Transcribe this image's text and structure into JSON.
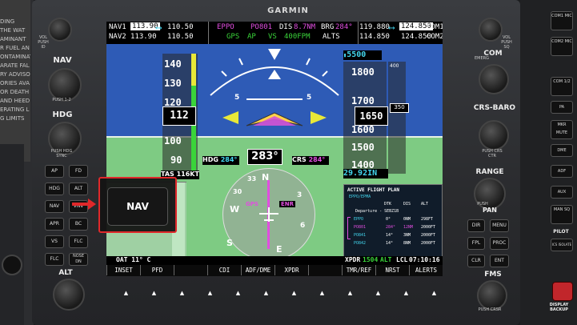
{
  "left_placard": {
    "lines": [
      "DING",
      "THE WAT",
      "AMINANT",
      "R FUEL AN",
      "ONTAMINAT",
      "ARATE FAL",
      "RY ADVISO",
      "ORIES AVA",
      "OR DEATH",
      "",
      "",
      "AND HEED",
      "ERATING L",
      "G LIMITS"
    ]
  },
  "left_controls": {
    "vol_label": "VOL PUSH ID",
    "nav_label": "NAV",
    "nav_push_label": "PUSH 1-2",
    "hdg_label": "HDG",
    "hdg_push_label": "PUSH HDG SYNC",
    "ap_buttons": [
      {
        "left": "AP",
        "right": "FD"
      },
      {
        "left": "HDG",
        "right": "ALT"
      },
      {
        "left": "NAV",
        "right": "VNV"
      },
      {
        "left": "APR",
        "right": "BC"
      },
      {
        "left": "VS",
        "right": "FLC"
      },
      {
        "left": "FLC",
        "right": "NOSE DN"
      }
    ],
    "alt_label": "ALT"
  },
  "top": {
    "brand": "GARMIN"
  },
  "nav_status": {
    "nav1_label": "NAV1",
    "nav1_active": "113.90",
    "nav1_standby": "110.50",
    "nav2_label": "NAV2",
    "nav2_active": "113.90",
    "nav2_standby": "110.50",
    "waypoint": "EPPO",
    "leg": "PO801",
    "dis_label": "DIS",
    "dis_value": "8.7NM",
    "brg_label": "BRG",
    "brg_value": "284°",
    "gps_label": "GPS",
    "ap_label": "AP",
    "vs_label": "VS",
    "vs_value": "400FPM",
    "alts_label": "ALTS",
    "com1_standby": "119.880",
    "com1_active": "124.850",
    "com1_label": "COM1",
    "com2_standby": "114.850",
    "com2_active": "124.850",
    "com2_label": "COM2"
  },
  "airspeed": {
    "ticks": [
      "140",
      "130",
      "120",
      "110",
      "100",
      "90"
    ],
    "current": "112",
    "tas": "TAS 116KT"
  },
  "altimeter": {
    "selected": "5500",
    "ticks": [
      "1800",
      "1700",
      "1600",
      "1500",
      "1400"
    ],
    "current": "1650",
    "vs_ticks": [
      "400",
      "350"
    ],
    "baro": "29.92IN"
  },
  "attitude": {
    "pitch_labels": [
      "5",
      "5"
    ]
  },
  "heading": {
    "current": "283°",
    "hdg_bug_label": "HDG",
    "hdg_bug_value": "284°",
    "crs_label": "CRS",
    "crs_value": "284°"
  },
  "hsi": {
    "gps_tag": "GPS",
    "enr_tag": "ENR",
    "cardinals": [
      "N",
      "W",
      "S",
      "E",
      "3",
      "6",
      "30",
      "33"
    ]
  },
  "flight_plan": {
    "title": "ACTIVE FLIGHT PLAN",
    "subtitle": "EPPO/EPMA",
    "headers": [
      "DTK",
      "DIS",
      "ALT"
    ],
    "departure": "Departure - SEBZ1B",
    "rows": [
      {
        "wpt": "EPPO",
        "dtk": "0°",
        "dis": "0NM",
        "alt": "298FT"
      },
      {
        "wpt": "PO801",
        "dtk": "284°",
        "dis": "12NM",
        "alt": "2000FT"
      },
      {
        "wpt": "PO841",
        "dtk": "14°",
        "dis": "3NM",
        "alt": "2000FT"
      },
      {
        "wpt": "PO842",
        "dtk": "14°",
        "dis": "8NM",
        "alt": "2000FT"
      }
    ]
  },
  "bottom_status": {
    "oat": "OAT  11° C",
    "xpdr_label": "XPDR",
    "xpdr_code": "1504",
    "xpdr_mode": "ALT",
    "lcl_label": "LCL",
    "time": "07:10:16"
  },
  "softkeys": [
    "INSET",
    "PFD",
    "",
    "CDI",
    "ADF/DME",
    "XPDR",
    "",
    "TMR/REF",
    "NRST",
    "ALERTS"
  ],
  "nav_callout": {
    "label": "NAV"
  },
  "right_controls": {
    "vol_label": "VOL PUSH SQ",
    "com_label": "COM",
    "emerg_label": "EMERG",
    "crs_baro_label": "CRS-BARO",
    "crs_push_label": "PUSH CRS CTR",
    "range_label": "RANGE",
    "pan_label": "PAN",
    "push_pan_label": "PUSH",
    "buttons": [
      {
        "left": "DIR",
        "right": "MENU"
      },
      {
        "left": "FPL",
        "right": "PROC"
      },
      {
        "left": "CLR",
        "right": "ENT"
      }
    ],
    "fms_label": "FMS",
    "push_crsr_label": "PUSH CRSR"
  },
  "far_right": {
    "buttons": [
      "COM1 MIC",
      "COM2 MIC",
      "COM 1/2",
      "PA",
      "MKR MUTE",
      "DME",
      "ADF",
      "AUX",
      "MAN SQ",
      "PILOT",
      "ICS ISOLATE"
    ],
    "display_backup_label": "DISPLAY BACKUP"
  }
}
